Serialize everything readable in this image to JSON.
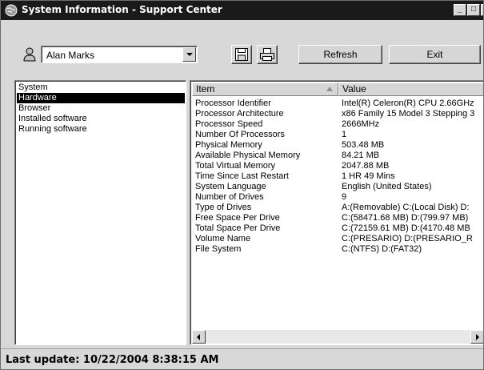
{
  "window": {
    "title": "System Information - Support Center",
    "controls": {
      "minimize": "_",
      "maximize": "□",
      "close": "×"
    }
  },
  "toolbar": {
    "user": "Alan Marks",
    "save_icon": "floppy-disk-icon",
    "print_icon": "printer-icon",
    "refresh_label": "Refresh",
    "exit_label": "Exit"
  },
  "categories": [
    {
      "label": "System",
      "selected": false
    },
    {
      "label": "Hardware",
      "selected": true
    },
    {
      "label": "Browser",
      "selected": false
    },
    {
      "label": "Installed software",
      "selected": false
    },
    {
      "label": "Running software",
      "selected": false
    }
  ],
  "details": {
    "columns": {
      "item": "Item",
      "value": "Value"
    },
    "rows": [
      {
        "item": "Processor Identifier",
        "value": "Intel(R) Celeron(R) CPU 2.66GHz"
      },
      {
        "item": "Processor Architecture",
        "value": "x86 Family 15 Model 3 Stepping 3"
      },
      {
        "item": "Processor Speed",
        "value": "2666MHz"
      },
      {
        "item": "Number Of Processors",
        "value": "1"
      },
      {
        "item": "Physical Memory",
        "value": "503.48 MB"
      },
      {
        "item": "Available Physical Memory",
        "value": "84.21 MB"
      },
      {
        "item": "Total Virtual Memory",
        "value": "2047.88 MB"
      },
      {
        "item": "Time Since Last Restart",
        "value": "1 HR 49 Mins"
      },
      {
        "item": "System Language",
        "value": "English (United States)"
      },
      {
        "item": "Number of Drives",
        "value": "9"
      },
      {
        "item": "Type of Drives",
        "value": "A:(Removable)  C:(Local Disk)  D:"
      },
      {
        "item": "Free Space Per Drive",
        "value": "C:(58471.68 MB)  D:(799.97 MB)"
      },
      {
        "item": "Total Space Per Drive",
        "value": "C:(72159.61 MB)  D:(4170.48 MB"
      },
      {
        "item": "Volume Name",
        "value": "C:(PRESARIO)  D:(PRESARIO_R"
      },
      {
        "item": "File System",
        "value": "C:(NTFS)  D:(FAT32)"
      }
    ]
  },
  "status": {
    "text": "Last update: 10/22/2004 8:38:15 AM"
  }
}
